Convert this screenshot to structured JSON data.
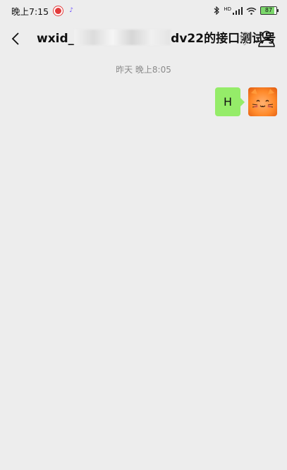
{
  "status_bar": {
    "time": "晚上7:15",
    "signal_label": "HD",
    "battery_level": "87"
  },
  "header": {
    "title_prefix": "wxid_",
    "title_suffix": "dv22的接口测试号"
  },
  "chat": {
    "timestamp": "昨天 晚上8:05",
    "messages": [
      {
        "text": "H",
        "sender": "self"
      }
    ]
  },
  "colors": {
    "bubble_self": "#95ec69",
    "background": "#ededed"
  }
}
